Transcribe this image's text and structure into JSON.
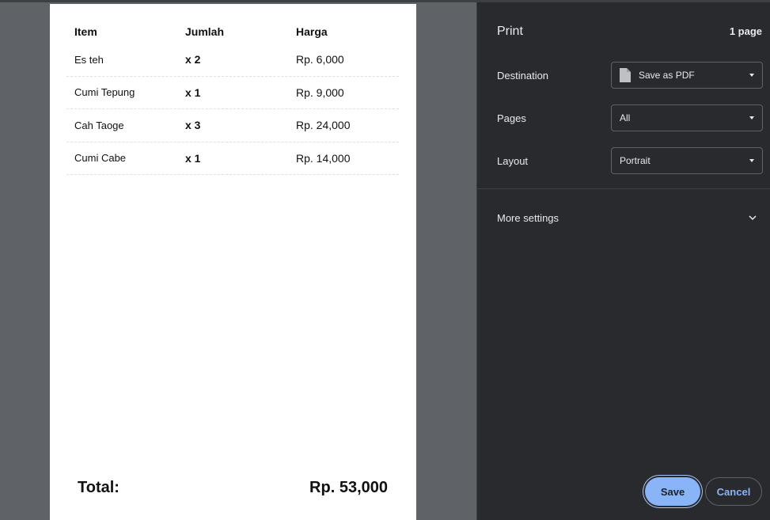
{
  "receipt": {
    "headers": {
      "item": "Item",
      "qty": "Jumlah",
      "price": "Harga"
    },
    "rows": [
      {
        "item": "Es teh",
        "qty": "x 2",
        "price": "Rp. 6,000"
      },
      {
        "item": "Cumi Tepung",
        "qty": "x 1",
        "price": "Rp. 9,000"
      },
      {
        "item": "Cah Taoge",
        "qty": "x 3",
        "price": "Rp. 24,000"
      },
      {
        "item": "Cumi Cabe",
        "qty": "x 1",
        "price": "Rp. 14,000"
      }
    ],
    "total_label": "Total:",
    "total_value": "Rp. 53,000"
  },
  "print": {
    "title": "Print",
    "page_count": "1 page",
    "destination": {
      "label": "Destination",
      "value": "Save as PDF",
      "icon": "document-icon"
    },
    "pages": {
      "label": "Pages",
      "value": "All"
    },
    "layout": {
      "label": "Layout",
      "value": "Portrait"
    },
    "more_settings": "More settings",
    "save_label": "Save",
    "cancel_label": "Cancel"
  },
  "colors": {
    "panel_bg": "#292a2d",
    "preview_bg": "#5f6368",
    "accent": "#8ab4f8"
  }
}
